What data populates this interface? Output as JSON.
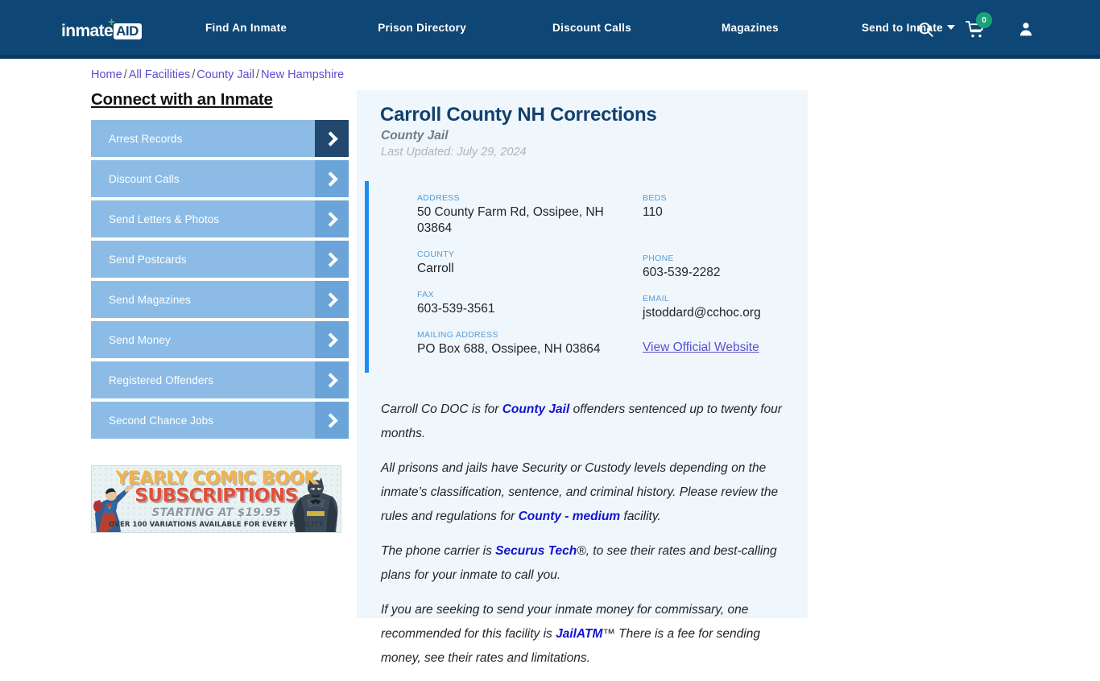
{
  "header": {
    "logo": {
      "word": "inmate",
      "box": "AID",
      "plus": "+"
    },
    "nav": [
      {
        "label": "Find An Inmate"
      },
      {
        "label": "Prison Directory"
      },
      {
        "label": "Discount Calls"
      },
      {
        "label": "Magazines"
      },
      {
        "label": "Send to Inmate",
        "has_caret": true
      }
    ],
    "icons": {
      "search": "search-icon",
      "cart": "cart-icon",
      "cart_count": "0",
      "user": "user-icon"
    },
    "colors": {
      "bar": "#0e4675",
      "badge": "#1aa179"
    }
  },
  "breadcrumb": {
    "items": [
      "Home",
      "All Facilities",
      "County Jail",
      "New Hampshire"
    ],
    "separator": "/"
  },
  "sidebar": {
    "title": "Connect with an Inmate",
    "items": [
      {
        "label": "Arrest Records",
        "active": true
      },
      {
        "label": "Discount Calls",
        "active": false
      },
      {
        "label": "Send Letters & Photos",
        "active": false
      },
      {
        "label": "Send Postcards",
        "active": false
      },
      {
        "label": "Send Magazines",
        "active": false
      },
      {
        "label": "Send Money",
        "active": false
      },
      {
        "label": "Registered Offenders",
        "active": false
      },
      {
        "label": "Second Chance Jobs",
        "active": false
      }
    ]
  },
  "ad": {
    "line1": "YEARLY COMIC BOOK",
    "line2": "SUBSCRIPTIONS",
    "line3": "STARTING AT $19.95",
    "line4": "OVER 100 VARIATIONS AVAILABLE FOR EVERY FACILITY"
  },
  "facility": {
    "title": "Carroll County NH Corrections",
    "subtitle": "County Jail",
    "last_updated": "Last Updated: July 29, 2024",
    "fields": {
      "address_label": "ADDRESS",
      "address_value": "50 County Farm Rd, Ossipee, NH 03864",
      "county_label": "COUNTY",
      "county_value": "Carroll",
      "fax_label": "FAX",
      "fax_value": "603-539-3561",
      "mailing_label": "MAILING ADDRESS",
      "mailing_value": "PO Box 688, Ossipee, NH 03864",
      "beds_label": "BEDS",
      "beds_value": "110",
      "phone_label": "PHONE",
      "phone_value": "603-539-2282",
      "email_label": "EMAIL",
      "email_value": "jstoddard@cchoc.org",
      "website_link": "View Official Website"
    },
    "paragraphs": {
      "p1a": "Carroll Co DOC is for ",
      "p1link": "County Jail",
      "p1b": " offenders sentenced up to twenty four months.",
      "p2a": "All prisons and jails have Security or Custody levels depending on the inmate’s classification, sentence, and criminal history. Please review the rules and regulations for ",
      "p2link": "County - medium",
      "p2b": " facility.",
      "p3a": "The phone carrier is ",
      "p3link": "Securus Tech",
      "p3reg": "®",
      "p3b": ", to see their rates and best-calling plans for your inmate to call you.",
      "p4a": "If you are seeking to send your inmate money for commissary, one recommended for this facility is ",
      "p4link": "JailATM",
      "p4tm": "™",
      "p4b": " There is a fee for sending money, see their rates and limitations."
    }
  },
  "colors": {
    "header_blue": "#0e4675",
    "card_bg": "#eff7fd",
    "accent_bar": "#1f8cf0",
    "title_navy": "#12406e",
    "sidebar_btn": "#8cbce6",
    "sidebar_arrow": "#6ba4d8",
    "sidebar_arrow_active": "#22486f",
    "link_purple": "#5a4fcf",
    "link_blue": "#1414cc"
  }
}
